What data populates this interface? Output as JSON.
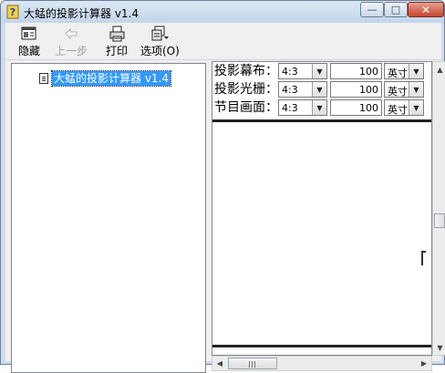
{
  "window": {
    "title": "大蜢的投影计算器 v1.4",
    "controls": {
      "minimize": "—",
      "maximize": "□",
      "close": "✕"
    }
  },
  "toolbar": {
    "items": [
      {
        "label": "隐藏",
        "icon": "hide-icon",
        "enabled": true
      },
      {
        "label": "上一步",
        "icon": "back-arrow-icon",
        "enabled": false
      },
      {
        "label": "打印",
        "icon": "printer-icon",
        "enabled": true
      },
      {
        "label": "选项(O)",
        "icon": "options-icon",
        "enabled": true
      }
    ]
  },
  "tree": {
    "items": [
      {
        "label": "大蜢的投影计算器 v1.4",
        "icon": "document-icon",
        "selected": true
      }
    ]
  },
  "form": {
    "rows": [
      {
        "label": "投影幕布：",
        "ratio": "4:3",
        "value": "100",
        "unit": "英寸"
      },
      {
        "label": "投影光栅：",
        "ratio": "4:3",
        "value": "100",
        "unit": "英寸"
      },
      {
        "label": "节目画面：",
        "ratio": "4:3",
        "value": "100",
        "unit": "英寸"
      }
    ]
  },
  "colors": {
    "selection": "#3399ff",
    "window_frame": "#cfdcec"
  }
}
